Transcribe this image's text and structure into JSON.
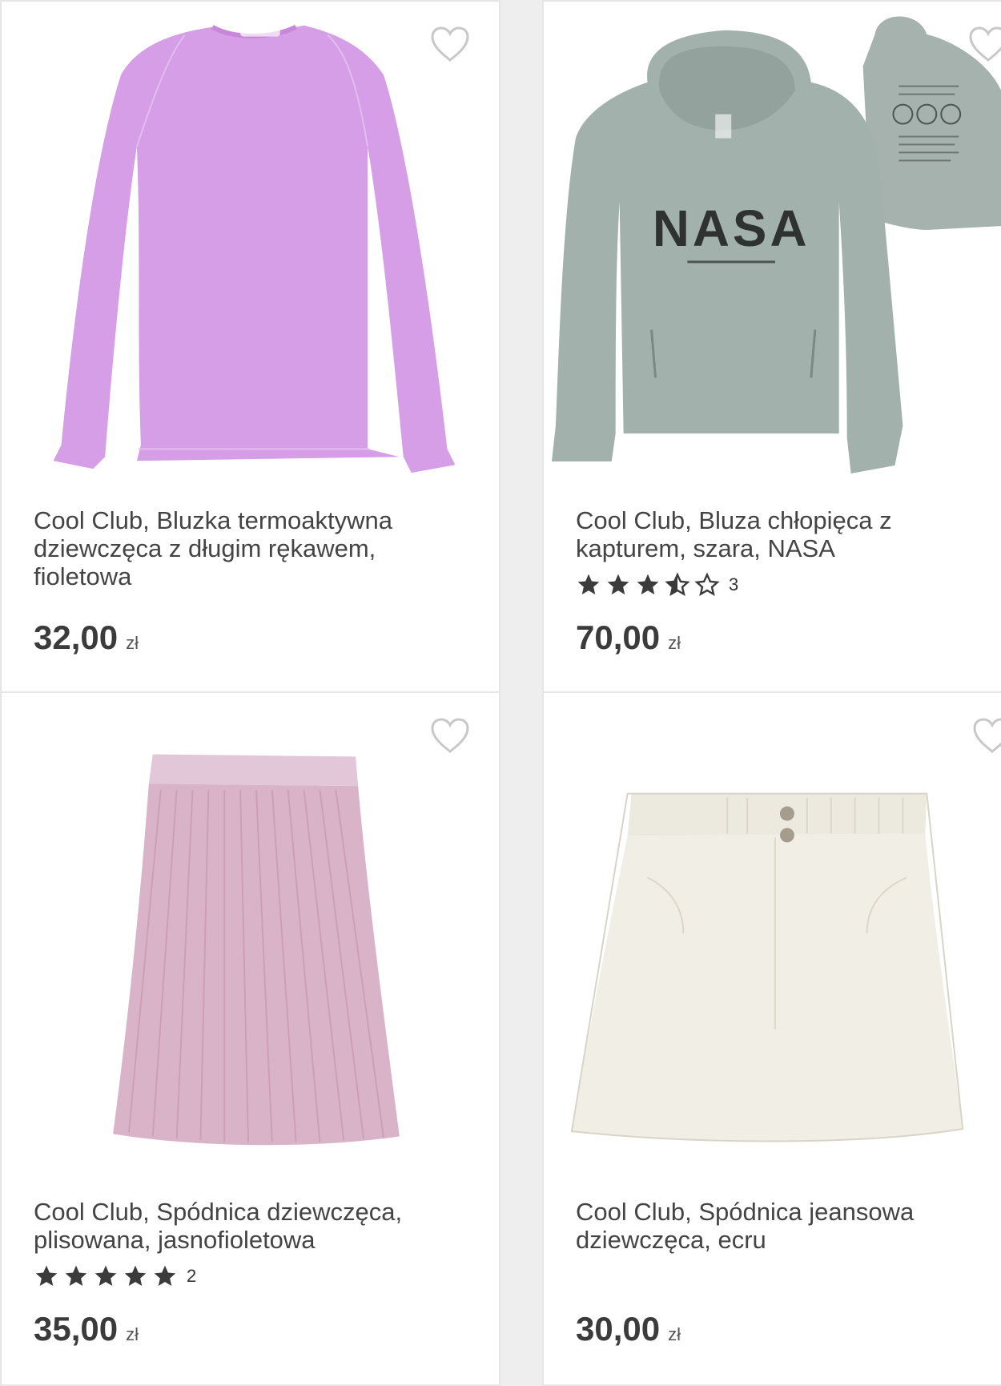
{
  "colors": {
    "background": "#eeeeee",
    "card": "#ffffff",
    "text": "#444444",
    "star": "#3b3b3b",
    "heart": "#c8c8c8"
  },
  "products": [
    {
      "title": "Cool Club, Bluzka termoaktywna dziewczęca z długim rękawem, fioletowa",
      "price": "32,00",
      "currency": "zł",
      "image": "pink-long-sleeve-top",
      "rating": null,
      "reviews": null
    },
    {
      "title": "Cool Club, Bluza chłopięca z kapturem, szara, NASA",
      "price": "70,00",
      "currency": "zł",
      "image": "grey-nasa-hoodie",
      "print_text": "NASA",
      "rating": 3.5,
      "reviews": "3"
    },
    {
      "title": "Cool Club, Spódnica dziewczęca, plisowana, jasnofioletowa",
      "price": "35,00",
      "currency": "zł",
      "image": "pleated-pink-skirt",
      "rating": 5,
      "reviews": "2"
    },
    {
      "title": "Cool Club, Spódnica jeansowa dziewczęca, ecru",
      "price": "30,00",
      "currency": "zł",
      "image": "ecru-denim-skirt",
      "rating": null,
      "reviews": null
    }
  ]
}
